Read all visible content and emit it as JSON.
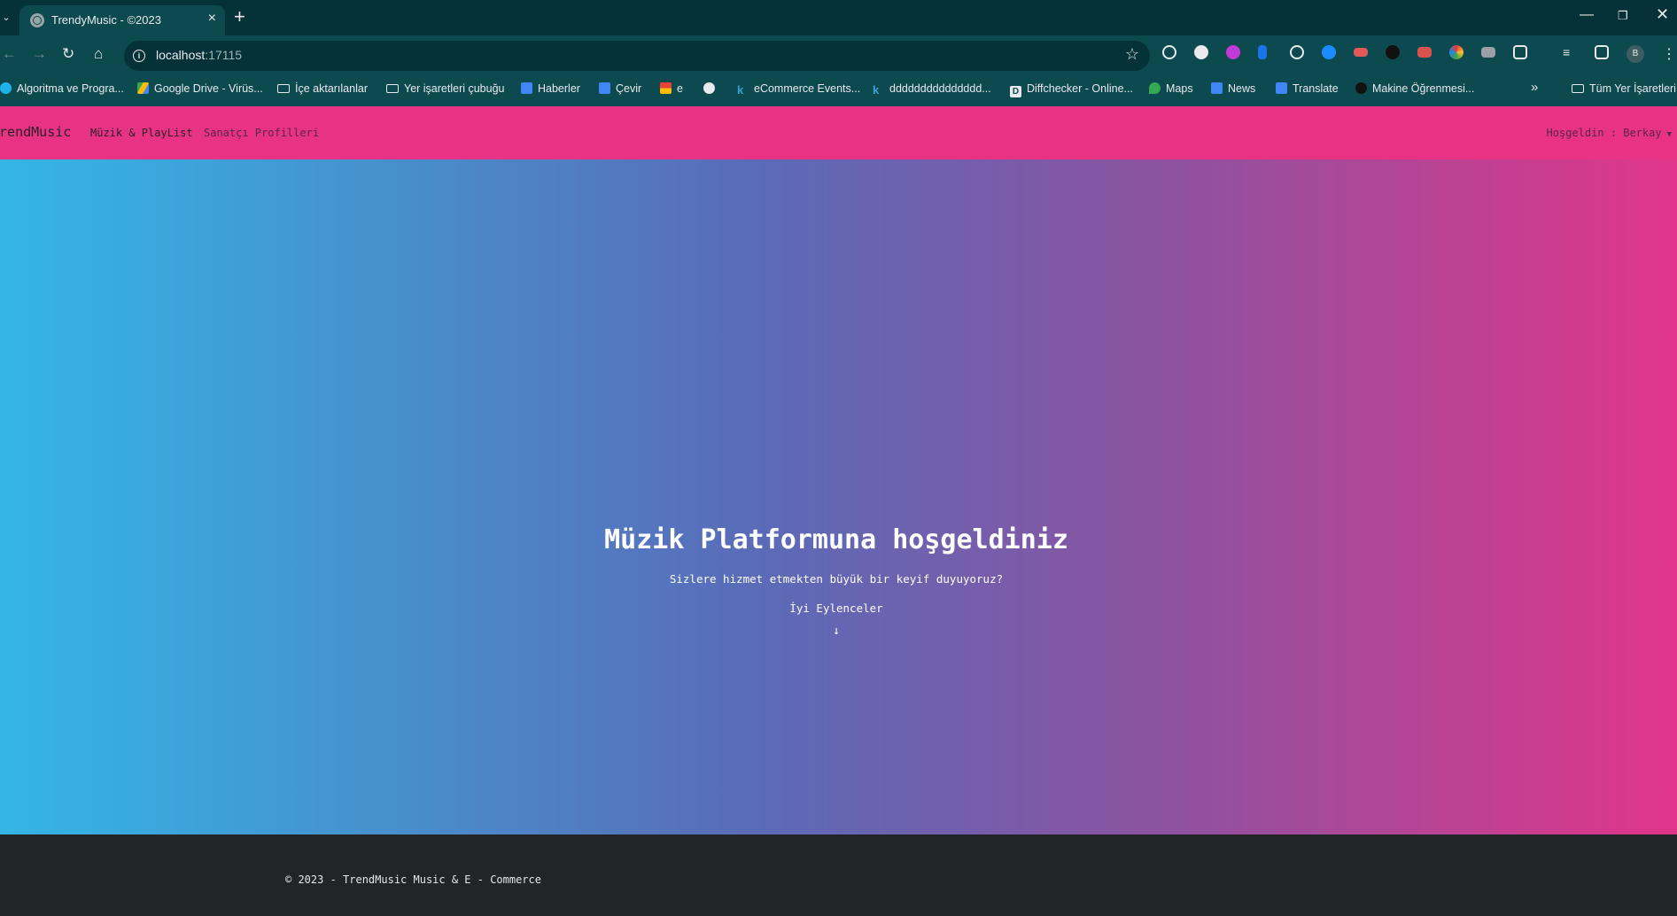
{
  "browser": {
    "tab_title": "TrendyMusic - ©2023",
    "url_host": "localhost",
    "url_port": ":17115",
    "profile_initial": "B",
    "bookmarks": [
      {
        "label": "Algoritma ve Progra...",
        "icon": "edge-like-icon"
      },
      {
        "label": "Google Drive - Virüs...",
        "icon": "google-drive-icon"
      },
      {
        "label": "İçe aktarılanlar",
        "icon": "folder-icon"
      },
      {
        "label": "Yer işaretleri çubuğu",
        "icon": "folder-icon"
      },
      {
        "label": "Haberler",
        "icon": "google-news-icon"
      },
      {
        "label": "Çevir",
        "icon": "google-translate-icon"
      },
      {
        "label": "e",
        "icon": "gmail-icon"
      },
      {
        "label": "",
        "icon": "globe-icon"
      },
      {
        "label": "eCommerce Events...",
        "icon": "k-icon"
      },
      {
        "label": "ddddddddddddddd...",
        "icon": "k-icon"
      },
      {
        "label": "Diffchecker - Online...",
        "icon": "diffchecker-icon"
      },
      {
        "label": "Maps",
        "icon": "google-maps-icon"
      },
      {
        "label": "News",
        "icon": "google-news-icon"
      },
      {
        "label": "Translate",
        "icon": "google-translate-icon"
      },
      {
        "label": "Makine Öğrenmesi...",
        "icon": "wordpress-icon"
      }
    ],
    "bookmarks_overflow": "»",
    "all_bookmarks": "Tüm Yer İşaretleri"
  },
  "navbar": {
    "brand": "TrendMusic",
    "links": [
      "Müzik & PlayList",
      "Sanatçı Profilleri"
    ],
    "user_greeting": "Hoşgeldin : Berkay"
  },
  "hero": {
    "title": "Müzik Platformuna hoşgeldiniz",
    "subtitle": "Sizlere hizmet etmekten büyük bir keyif duyuyoruz?",
    "fun": "İyi Eylenceler",
    "arrow": "↓"
  },
  "footer": {
    "text": "© 2023 - TrendMusic Music & E - Commerce"
  }
}
